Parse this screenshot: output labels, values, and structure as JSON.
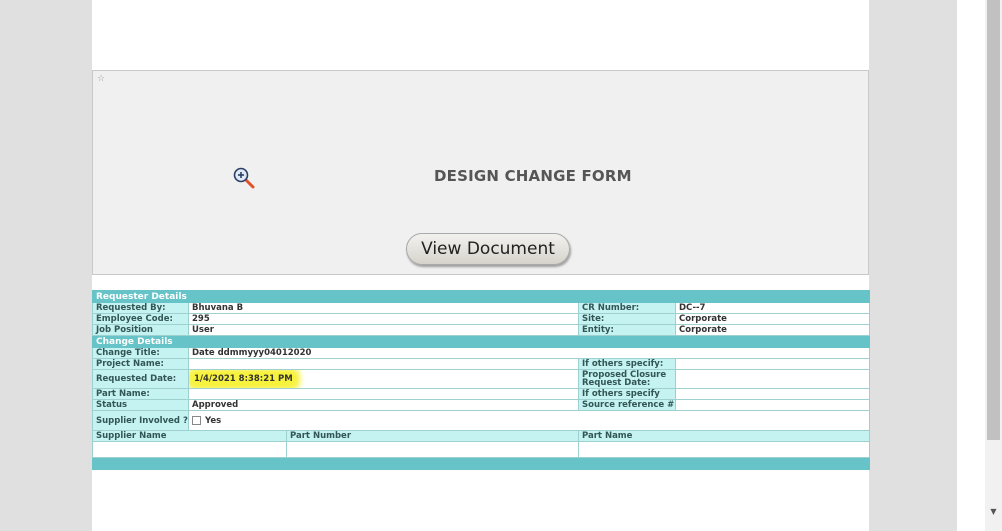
{
  "viewer": {
    "title": "DESIGN CHANGE FORM",
    "view_button": "View Document",
    "zoom_icon": "zoom-in-icon"
  },
  "requester": {
    "section_title": "Requester Details",
    "requested_by_label": "Requested By:",
    "requested_by": "Bhuvana B",
    "cr_number_label": "CR Number:",
    "cr_number": "DC--7",
    "employee_code_label": "Employee Code:",
    "employee_code": "295",
    "site_label": "Site:",
    "site": "Corporate",
    "job_position_label": "Job Position",
    "job_position": "User",
    "entity_label": "Entity:",
    "entity": "Corporate"
  },
  "change": {
    "section_title": "Change Details",
    "change_title_label": "Change Title:",
    "change_title": "Date ddmmyyy04012020",
    "project_name_label": "Project Name:",
    "if_others_label": "If others specify:",
    "requested_date_label": "Requested Date:",
    "requested_date": "1/4/2021 8:38:21 PM",
    "proposed_closure_label_1": "Proposed Closure",
    "proposed_closure_label_2": "Request Date:",
    "part_name_label": "Part Name:",
    "if_others_label_2": "If others specify",
    "status_label": "Status",
    "status": "Approved",
    "source_ref_label": "Source reference #:",
    "supplier_involved_label": "Supplier Involved ?",
    "supplier_yes": "Yes",
    "supplier_name_col": "Supplier Name",
    "part_number_col": "Part Number",
    "part_name_col": "Part Name"
  }
}
